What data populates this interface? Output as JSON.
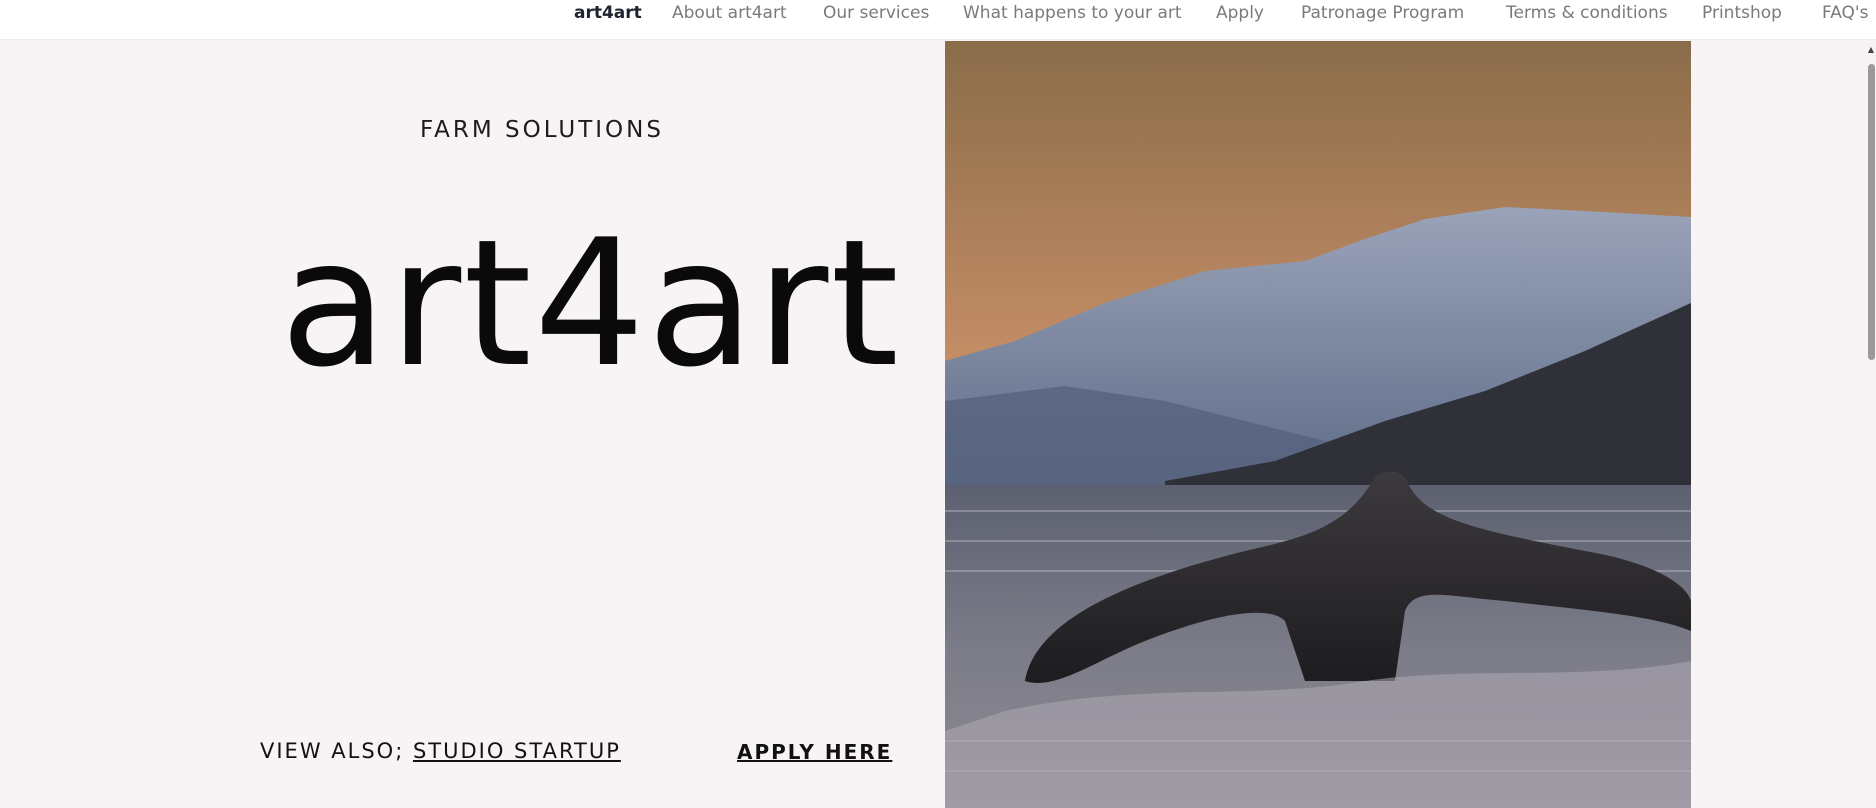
{
  "nav": {
    "items": [
      {
        "label": "art4art",
        "active": true
      },
      {
        "label": "About art4art",
        "active": false
      },
      {
        "label": "Our services",
        "active": false
      },
      {
        "label": "What happens to your art",
        "active": false
      },
      {
        "label": "Apply",
        "active": false
      },
      {
        "label": "Patronage Program",
        "active": false
      },
      {
        "label": "Terms & conditions",
        "active": false
      },
      {
        "label": "Printshop",
        "active": false
      },
      {
        "label": "FAQ's",
        "active": false
      }
    ]
  },
  "hero": {
    "kicker": "FARM SOLUTIONS",
    "brand": "art4art",
    "see_also_prefix": "VIEW ALSO; ",
    "see_also_link": "STUDIO STARTUP",
    "apply_label": "APPLY HERE",
    "photo_icon": "whale-tail-photo"
  },
  "colors": {
    "background": "#f8f4f5",
    "nav_text": "#7a7a7a",
    "nav_active": "#1f2230",
    "text": "#0a0a0a"
  }
}
